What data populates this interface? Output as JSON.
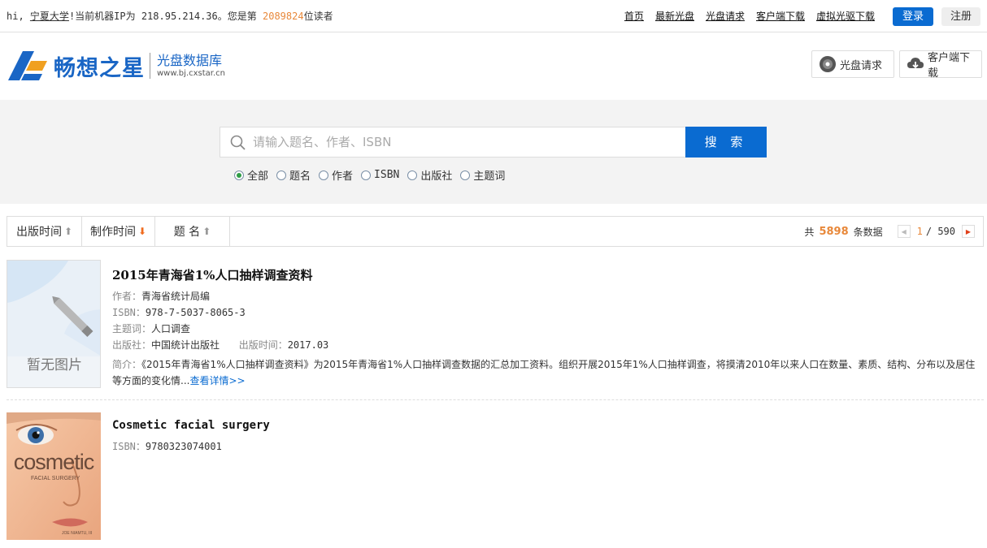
{
  "topbar": {
    "greeting": "hi,",
    "school": "宁夏大学",
    "ip_text": "!当前机器IP为 218.95.214.36。您是第",
    "visitor_count": "2089824",
    "visitor_suffix": "位读者",
    "nav": [
      "首页",
      "最新光盘",
      "光盘请求",
      "客户端下载",
      "虚拟光驱下载"
    ],
    "login_label": "登录",
    "register_label": "注册"
  },
  "header": {
    "brand": "畅想之星",
    "subtitle": "光盘数据库",
    "url": "www.bj.cxstar.cn",
    "disc_request_label": "光盘请求",
    "client_download_label": "客户端下载"
  },
  "search": {
    "placeholder": "请输入题名、作者、ISBN",
    "button_label": "搜 索",
    "options": [
      "全部",
      "题名",
      "作者",
      "ISBN",
      "出版社",
      "主题词"
    ],
    "selected": "全部"
  },
  "sortbar": {
    "publish_time": "出版时间",
    "make_time": "制作时间",
    "title": "题 名",
    "total_prefix": "共",
    "total": "5898",
    "total_suffix": "条数据",
    "current_page": "1",
    "page_sep": "/ 590"
  },
  "results": [
    {
      "title": "2015年青海省1%人口抽样调查资料",
      "cover_text": "暂无图片",
      "author_label": "作者：",
      "author": "青海省统计局编",
      "isbn_label": "ISBN：",
      "isbn": "978-7-5037-8065-3",
      "subject_label": "主题词：",
      "subject": "人口调查",
      "publisher_label": "出版社：",
      "publisher": "中国统计出版社",
      "pubdate_label": "出版时间：",
      "pubdate": "2017.03",
      "abstract_label": "简介：",
      "abstract": "《2015年青海省1%人口抽样调查资料》为2015年青海省1%人口抽样调查数据的汇总加工资料。组织开展2015年1%人口抽样调查，将摸清2010年以来人口在数量、素质、结构、分布以及居住等方面的变化情...",
      "more_label": "查看详情>>"
    },
    {
      "title": "Cosmetic facial surgery",
      "isbn_label": "ISBN：",
      "isbn": "9780323074001",
      "cover_title": "cosmetic",
      "cover_subtitle": "FACIAL SURGERY",
      "cover_author": "JOE NIAMTU, III"
    }
  ]
}
